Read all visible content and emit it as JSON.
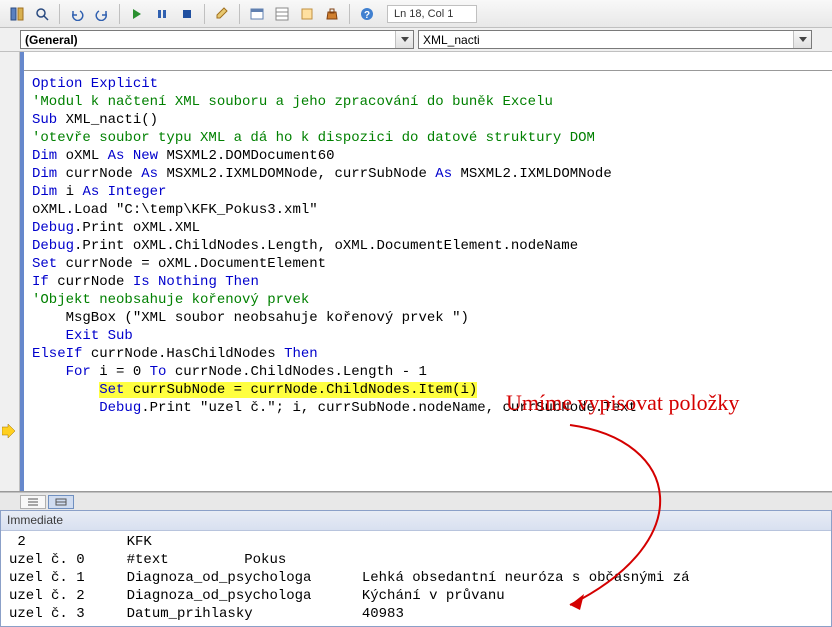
{
  "toolbar": {
    "lncol": "Ln 18, Col 1"
  },
  "dropdowns": {
    "object": "(General)",
    "proc": "XML_nacti"
  },
  "code": {
    "l1a": "Option Explicit",
    "l2": "'Modul k načtení XML souboru a jeho zpracování do buněk Excelu",
    "l3a": "Sub",
    "l3b": " XML_nacti()",
    "l4": "'otevře soubor typu XML a dá ho k dispozici do datové struktury DOM",
    "l5a": "Dim",
    "l5b": " oXML ",
    "l5c": "As New",
    "l5d": " MSXML2.DOMDocument60",
    "l6a": "Dim",
    "l6b": " currNode ",
    "l6c": "As",
    "l6d": " MSXML2.IXMLDOMNode, currSubNode ",
    "l6e": "As",
    "l6f": " MSXML2.IXMLDOMNode",
    "l7a": "Dim",
    "l7b": " i ",
    "l7c": "As Integer",
    "l8": "oXML.Load \"C:\\temp\\KFK_Pokus3.xml\"",
    "l9a": "Debug",
    "l9b": ".Print oXML.XML",
    "l10a": "Debug",
    "l10b": ".Print oXML.ChildNodes.Length, oXML.DocumentElement.nodeName",
    "l11a": "Set",
    "l11b": " currNode = oXML.DocumentElement",
    "l12a": "If",
    "l12b": " currNode ",
    "l12c": "Is Nothing Then",
    "l13": "'Objekt neobsahuje kořenový prvek",
    "l14": "    MsgBox (\"XML soubor neobsahuje kořenový prvek \")",
    "l15a": "    ",
    "l15b": "Exit Sub",
    "l16a": "ElseIf",
    "l16b": " currNode.HasChildNodes ",
    "l16c": "Then",
    "l17a": "    ",
    "l17b": "For",
    "l17c": " i = 0 ",
    "l17d": "To",
    "l17e": " currNode.ChildNodes.Length - 1",
    "l18a": "        ",
    "l18b": "Set",
    "l18c": " currSubNode = currNode.ChildNodes.Item(i)",
    "l19a": "        ",
    "l19b": "Debug",
    "l19c": ".Print \"uzel č.\"; i, currSubNode.nodeName, currSubNode.Text"
  },
  "immediate": {
    "title": "Immediate",
    "l1": " 2            KFK",
    "l2": "uzel č. 0     #text         Pokus",
    "l3": "uzel č. 1     Diagnoza_od_psychologa      Lehká obsedantní neuróza s občasnými zá",
    "l4": "uzel č. 2     Diagnoza_od_psychologa      Kýchání v průvanu",
    "l5": "uzel č. 3     Datum_prihlasky             40983"
  },
  "annotation": "Umíme vypisovat položky"
}
